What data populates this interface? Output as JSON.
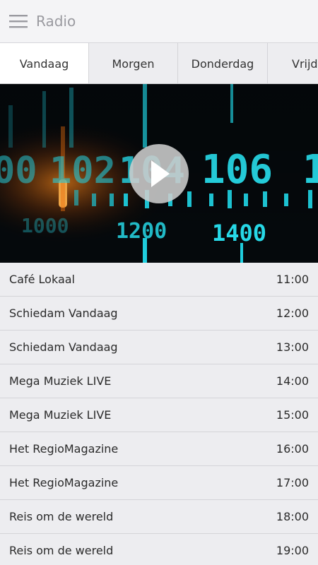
{
  "app": {
    "title": "Radio"
  },
  "tabs": [
    {
      "label": "Vandaag",
      "active": true
    },
    {
      "label": "Morgen",
      "active": false
    },
    {
      "label": "Donderdag",
      "active": false
    },
    {
      "label": "Vrijd",
      "active": false
    }
  ],
  "hero": {
    "dial_numbers": [
      "00",
      "102",
      "104",
      "106",
      "1000",
      "1200",
      "1400"
    ],
    "accent_color": "#19d6e6"
  },
  "schedule": [
    {
      "name": "Café Lokaal",
      "time": "11:00"
    },
    {
      "name": "Schiedam Vandaag",
      "time": "12:00"
    },
    {
      "name": "Schiedam Vandaag",
      "time": "13:00"
    },
    {
      "name": "Mega Muziek LIVE",
      "time": "14:00"
    },
    {
      "name": "Mega Muziek LIVE",
      "time": "15:00"
    },
    {
      "name": "Het RegioMagazine",
      "time": "16:00"
    },
    {
      "name": "Het RegioMagazine",
      "time": "17:00"
    },
    {
      "name": "Reis om de wereld",
      "time": "18:00"
    },
    {
      "name": "Reis om de wereld",
      "time": "19:00"
    }
  ]
}
